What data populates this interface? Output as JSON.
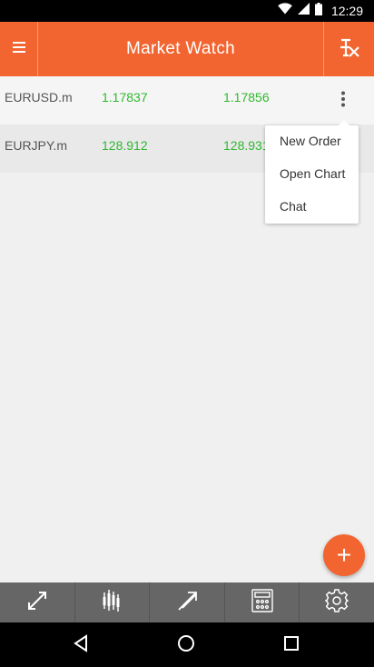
{
  "status_bar": {
    "time": "12:29"
  },
  "app_bar": {
    "title": "Market Watch",
    "menu_icon": "hamburger-menu-icon",
    "symbols_icon": "symbols-icon"
  },
  "quotes": [
    {
      "symbol": "EURUSD.m",
      "bid": "1.17837",
      "ask": "1.17856"
    },
    {
      "symbol": "EURJPY.m",
      "bid": "128.912",
      "ask": "128.931"
    }
  ],
  "context_menu": {
    "items": [
      "New Order",
      "Open Chart",
      "Chat"
    ]
  },
  "fab": {
    "label": "+"
  },
  "toolbar": {
    "items": [
      "fullscreen-icon",
      "chart-icon",
      "trade-icon",
      "calculator-icon",
      "settings-icon"
    ]
  },
  "colors": {
    "accent": "#f26531",
    "price_up": "#2eb82e",
    "toolbar": "#666666"
  }
}
